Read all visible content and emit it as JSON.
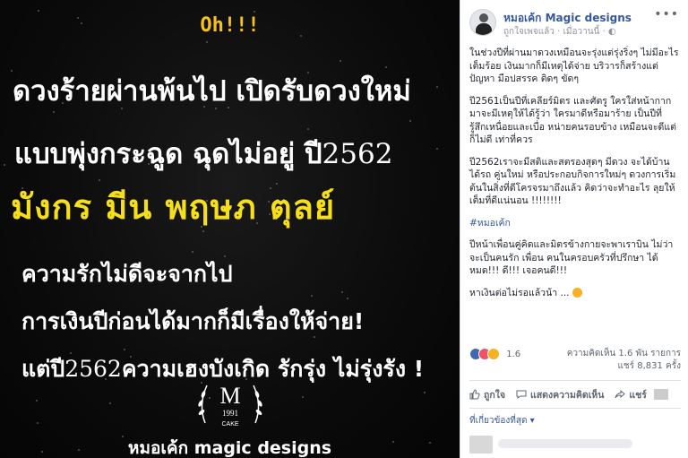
{
  "image": {
    "exclaim": "Oh!!!",
    "line1": "ดวงร้ายผ่านพ้นไป เปิดรับดวงใหม่",
    "line2_text": "แบบพุ่งกระฉูด ฉุดไม่อยู่ ปี",
    "line2_year": "2562",
    "line3": "มังกร มีน พฤษภ ตุลย์",
    "line4": "ความรักไม่ดีจะจากไป",
    "line5": "การเงินปีก่อนได้มากก็มีเรื่องให้จ่าย!",
    "line6_prefix": "แต่ปี",
    "line6_year": "2562",
    "line6_text": "ความเฮงบังเกิด รักรุ่ง ไม่รุ่งรัง !",
    "logo_letter": "M",
    "logo_year": "1991",
    "logo_word": "CAKE",
    "brand": "หมอเค้ก magic designs"
  },
  "post": {
    "page_name": "หมอเค้ก Magic designs",
    "meta": "ถูกใจเพจแล้ว · เมื่อวานนี้ ·",
    "paragraphs": [
      "ในช่วงปีที่ผ่านมาดวงเหมือนจะรุ่งแต่รุ่งริ่งๆ ไม่มีอะไรเต็มร้อย เงินมากก็มีเหตุได้จ่าย บริวารก็สร้างแต่ปัญหา มือปสรรค ติดๆ ขัดๆ",
      "ปี2561เป็นปีที่เคลียร์มิตร และศัตรู ใครใส่หน้ากากมาจะมีเหตุให้ได้รู้ว่า ใครมาดีหรือมาร้าย เป็นปีที่ รู้สึกเหนื่อยและเบื่อ หน่ายคนรอบข้าง เหมือนจะดีแต่ก็ไม่ดี เท่าที่ควร",
      "ปี2562เราจะมีสติและสตรองสุดๆ มีดวง จะได้บ้าน ได้รถ คู่นใหม่ หรือประกอบกิจการใหม่ๆ ดวงการเริ่ม ต้นในสิ่งที่ดีโครจรมาถึงแล้ว คิดว่าจะทำอะไร ลุยให้ เต็มที่ดีแน่นอน !!!!!!!!"
    ],
    "hashtag": "#หมอเค้ก",
    "paragraph4": "ปีหน้าเพื่อนคู่คิดและมิตรข้างกายจะพาเราบิน ไม่ว่าจะเป็นคนรัก เพื่อน คนในครอบครัวที่ปรึกษา ได้หมด!!! ดี!!! เจอคนดี!!!",
    "paragraph5": "หาเงินต่อไม่รอแล้วน้า ...",
    "reaction_count": "1.6",
    "stats_line1": "ความคิดเห็น 1.6 พัน รายการ",
    "stats_line2": "แชร์ 8,831 ครั้ง",
    "like_label": "ถูกใจ",
    "comment_label": "แสดงความคิดเห็น",
    "share_label": "แชร์",
    "relevant_label": "ที่เกี่ยวข้องที่สุด ▾"
  },
  "colors": {
    "accent": "#365899",
    "headline_yellow": "#f5df1a",
    "exclaim_yellow": "#f4c21a"
  }
}
